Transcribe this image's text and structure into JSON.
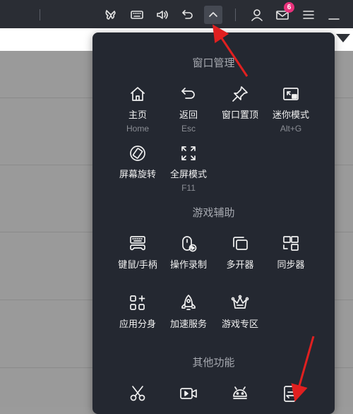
{
  "toolbar": {
    "badge_count": "6",
    "icons": [
      "butterfly-icon",
      "keyboard-icon",
      "volume-icon",
      "undo-icon",
      "chevron-up-icon",
      "user-icon",
      "mail-icon",
      "menu-icon",
      "minimize-icon"
    ]
  },
  "panel": {
    "sections": {
      "window": {
        "title": "窗口管理"
      },
      "game": {
        "title": "游戏辅助"
      },
      "other": {
        "title": "其他功能"
      }
    },
    "window_items": [
      {
        "label": "主页",
        "sub": "Home"
      },
      {
        "label": "返回",
        "sub": "Esc"
      },
      {
        "label": "窗口置顶",
        "sub": ""
      },
      {
        "label": "迷你模式",
        "sub": "Alt+G"
      },
      {
        "label": "屏幕旋转",
        "sub": ""
      },
      {
        "label": "全屏模式",
        "sub": "F11"
      }
    ],
    "game_items": [
      {
        "label": "键鼠/手柄"
      },
      {
        "label": "操作录制"
      },
      {
        "label": "多开器"
      },
      {
        "label": "同步器"
      },
      {
        "label": "应用分身"
      },
      {
        "label": "加速服务"
      },
      {
        "label": "游戏专区"
      }
    ]
  },
  "colors": {
    "panel_bg": "#242831",
    "topbar_bg": "#2a2d34",
    "badge": "#e8317b",
    "annotation_arrow": "#e02020"
  }
}
